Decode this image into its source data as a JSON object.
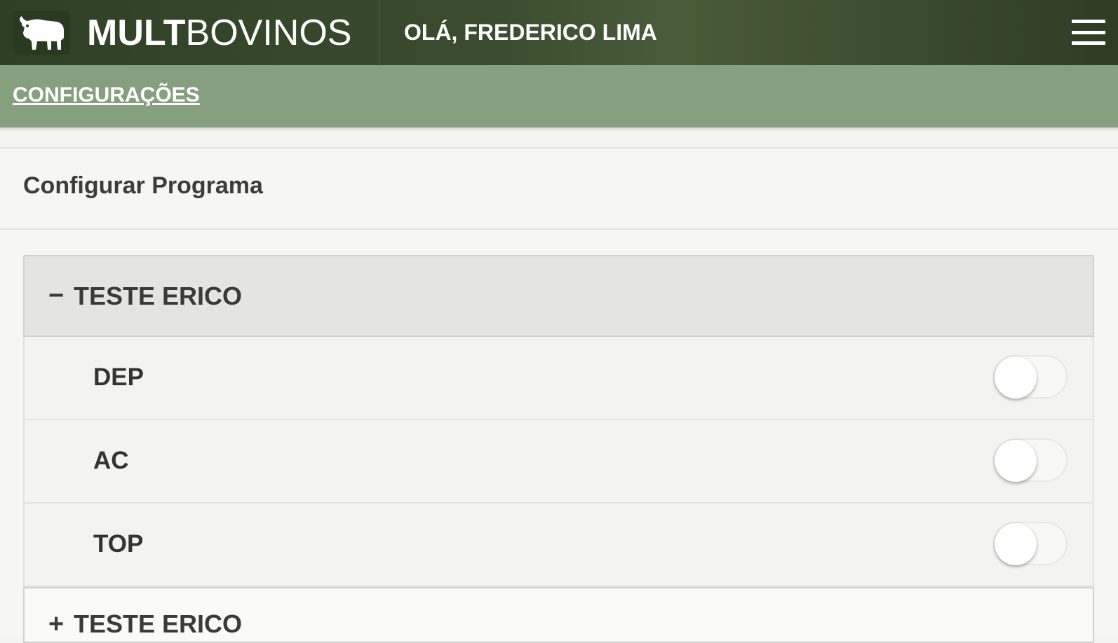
{
  "header": {
    "brand_bold": "MULT",
    "brand_light": "BOVINOS",
    "greeting": "OLÁ, FREDERICO LIMA",
    "logo_icon": "bull-icon",
    "menu_icon": "hamburger-menu-icon"
  },
  "subnav": {
    "link": "CONFIGURAÇÕES"
  },
  "card": {
    "title": "Configurar Programa"
  },
  "groups": [
    {
      "sign": "−",
      "label": "TESTE ERICO",
      "expanded": true,
      "items": [
        {
          "label": "DEP",
          "enabled": false
        },
        {
          "label": "AC",
          "enabled": false
        },
        {
          "label": "TOP",
          "enabled": false
        }
      ]
    },
    {
      "sign": "+",
      "label": "TESTE ERICO",
      "expanded": false
    }
  ],
  "colors": {
    "header_bg": "#3b4d2e",
    "subnav_bg": "#86a07f"
  }
}
